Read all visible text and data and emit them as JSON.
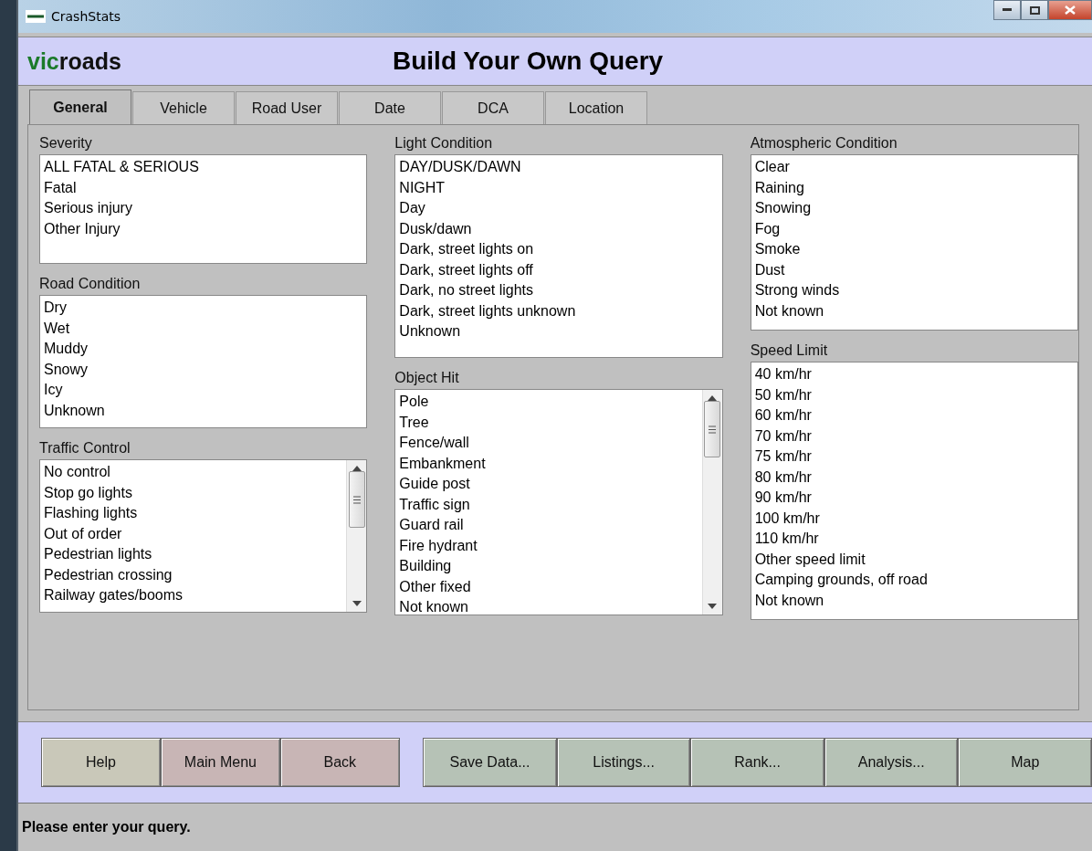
{
  "window": {
    "title": "CrashStats"
  },
  "header": {
    "logo_part_1": "vic",
    "logo_part_2": "roads",
    "title": "Build Your Own Query"
  },
  "tabs": [
    {
      "label": "General",
      "selected": true
    },
    {
      "label": "Vehicle",
      "selected": false
    },
    {
      "label": "Road User",
      "selected": false
    },
    {
      "label": "Date",
      "selected": false
    },
    {
      "label": "DCA",
      "selected": false
    },
    {
      "label": "Location",
      "selected": false
    }
  ],
  "columns": [
    {
      "sections": [
        {
          "label": "Severity",
          "kind": "plain",
          "items": [
            "ALL FATAL & SERIOUS",
            "Fatal",
            "Serious injury",
            "Other Injury"
          ]
        },
        {
          "label": "Road Condition",
          "kind": "plain",
          "items": [
            "Dry",
            "Wet",
            "Muddy",
            "Snowy",
            "Icy",
            "Unknown"
          ]
        },
        {
          "label": "Traffic Control",
          "kind": "scroll",
          "items": [
            "No control",
            "Stop go lights",
            "Flashing lights",
            "Out of order",
            "Pedestrian lights",
            "Pedestrian crossing",
            "Railway gates/booms"
          ]
        }
      ]
    },
    {
      "sections": [
        {
          "label": "Light Condition",
          "kind": "plain",
          "items": [
            "DAY/DUSK/DAWN",
            "NIGHT",
            "Day",
            "Dusk/dawn",
            "Dark, street lights on",
            "Dark, street lights off",
            "Dark, no street lights",
            "Dark, street lights unknown",
            "Unknown"
          ]
        },
        {
          "label": "Object Hit",
          "kind": "scroll",
          "items": [
            "Pole",
            "Tree",
            "Fence/wall",
            "Embankment",
            "Guide post",
            "Traffic sign",
            "Guard rail",
            "Fire hydrant",
            "Building",
            "Other fixed",
            "Not known"
          ]
        }
      ]
    },
    {
      "sections": [
        {
          "label": "Atmospheric Condition",
          "kind": "plain",
          "items": [
            "Clear",
            "Raining",
            "Snowing",
            "Fog",
            "Smoke",
            "Dust",
            "Strong winds",
            "Not known"
          ]
        },
        {
          "label": "Speed Limit",
          "kind": "plain",
          "items": [
            "40 km/hr",
            "50 km/hr",
            "60 km/hr",
            "70 km/hr",
            "75 km/hr",
            "80 km/hr",
            "90 km/hr",
            "100 km/hr",
            "110 km/hr",
            "Other speed limit",
            "Camping grounds, off road",
            "Not known"
          ]
        }
      ]
    }
  ],
  "buttons": [
    {
      "label": "Help",
      "color": "#c9c8b9"
    },
    {
      "label": "Main Menu",
      "color": "#c8b5b5"
    },
    {
      "label": "Back",
      "color": "#c8b5b5"
    },
    {
      "label": "Save Data...",
      "color": "#b6c2b6"
    },
    {
      "label": "Listings...",
      "color": "#b6c2b6"
    },
    {
      "label": "Rank...",
      "color": "#b6c2b6"
    },
    {
      "label": "Analysis...",
      "color": "#b6c2b6"
    },
    {
      "label": "Map",
      "color": "#b6c2b6"
    }
  ],
  "status_bar": "Please enter your query."
}
